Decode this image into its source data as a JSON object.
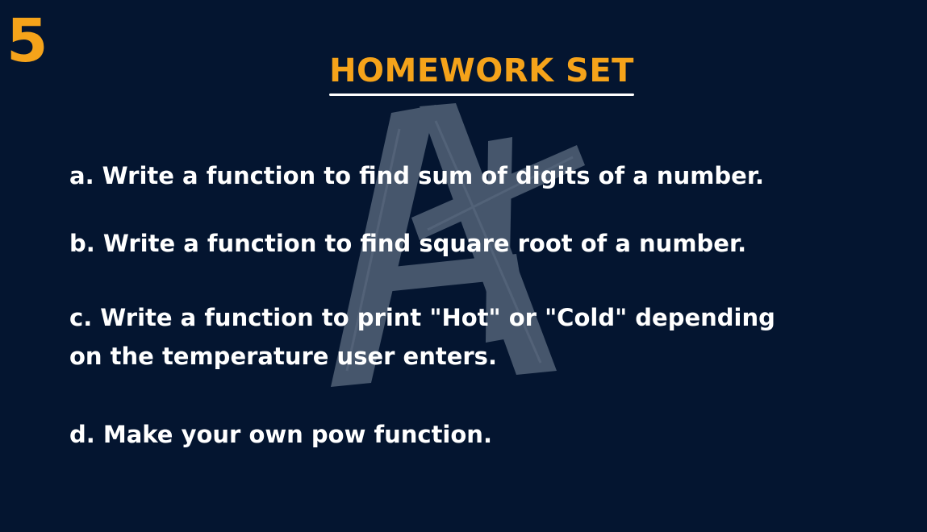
{
  "slide": {
    "number": "5",
    "title": "HOMEWORK SET",
    "tasks": [
      {
        "line1": "a. Write a function to find sum of digits of a number."
      },
      {
        "line1": "b. Write a function to find square root of a number."
      },
      {
        "line1": "c. Write a function to print \"Hot\" or \"Cold\" depending",
        "line2": "on the temperature user enters."
      },
      {
        "line1": "d. Make your own pow function."
      }
    ],
    "watermark_icon": "a-plus-logo-icon"
  },
  "colors": {
    "background": "#041530",
    "accent": "#f5a31a",
    "text": "#ffffff",
    "watermark": "#4a5a70"
  }
}
